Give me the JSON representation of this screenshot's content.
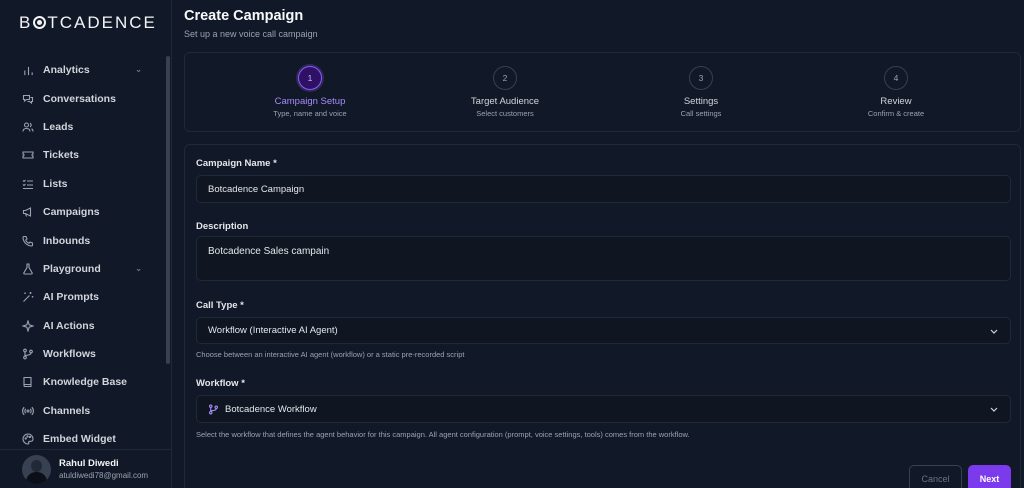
{
  "brand": {
    "logo_text_left": "B",
    "logo_text_right": "TCADENCE"
  },
  "sidebar": {
    "items": [
      {
        "label": "Analytics",
        "icon": "bar-chart-icon",
        "expandable": true
      },
      {
        "label": "Conversations",
        "icon": "chat-icon",
        "expandable": false
      },
      {
        "label": "Leads",
        "icon": "users-icon",
        "expandable": false
      },
      {
        "label": "Tickets",
        "icon": "ticket-icon",
        "expandable": false
      },
      {
        "label": "Lists",
        "icon": "list-icon",
        "expandable": false
      },
      {
        "label": "Campaigns",
        "icon": "megaphone-icon",
        "expandable": false
      },
      {
        "label": "Inbounds",
        "icon": "phone-icon",
        "expandable": false
      },
      {
        "label": "Playground",
        "icon": "flask-icon",
        "expandable": true
      },
      {
        "label": "AI Prompts",
        "icon": "wand-icon",
        "expandable": false
      },
      {
        "label": "AI Actions",
        "icon": "sparkle-icon",
        "expandable": false
      },
      {
        "label": "Workflows",
        "icon": "workflow-icon",
        "expandable": false
      },
      {
        "label": "Knowledge Base",
        "icon": "book-icon",
        "expandable": false
      },
      {
        "label": "Channels",
        "icon": "radio-icon",
        "expandable": false
      },
      {
        "label": "Embed Widget",
        "icon": "palette-icon",
        "expandable": false
      }
    ],
    "user": {
      "name": "Rahul Diwedi",
      "email": "atuldiwedi78@gmail.com"
    }
  },
  "header": {
    "title": "Create Campaign",
    "subtitle": "Set up a new voice call campaign"
  },
  "stepper": {
    "steps": [
      {
        "number": "1",
        "title": "Campaign Setup",
        "subtitle": "Type, name and voice",
        "active": true
      },
      {
        "number": "2",
        "title": "Target Audience",
        "subtitle": "Select customers",
        "active": false
      },
      {
        "number": "3",
        "title": "Settings",
        "subtitle": "Call settings",
        "active": false
      },
      {
        "number": "4",
        "title": "Review",
        "subtitle": "Confirm & create",
        "active": false
      }
    ]
  },
  "form": {
    "campaign_name": {
      "label": "Campaign Name *",
      "value": "Botcadence Campaign"
    },
    "description": {
      "label": "Description",
      "value": "Botcadence Sales campain"
    },
    "call_type": {
      "label": "Call Type *",
      "value": "Workflow (Interactive AI Agent)",
      "helper": "Choose between an interactive AI agent (workflow) or a static pre-recorded script"
    },
    "workflow": {
      "label": "Workflow *",
      "value": "Botcadence Workflow",
      "helper": "Select the workflow that defines the agent behavior for this campaign. All agent configuration (prompt, voice settings, tools) comes from the workflow."
    },
    "cancel_label": "Cancel",
    "next_label": "Next"
  },
  "colors": {
    "accent": "#7c3aed",
    "background": "#111827"
  }
}
